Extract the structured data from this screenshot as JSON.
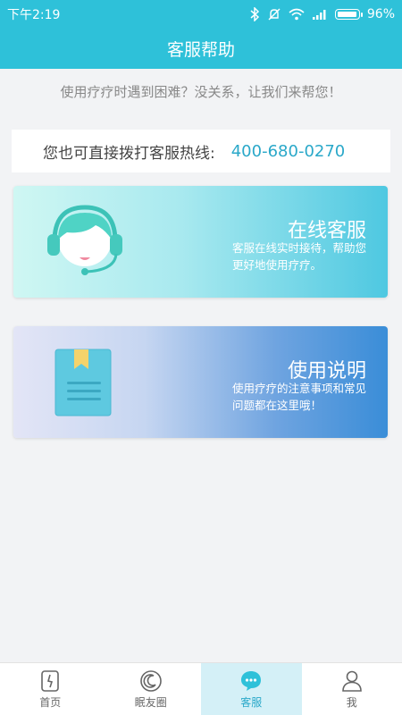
{
  "status_bar": {
    "time": "下午2:19",
    "battery": "96%",
    "battery_level": 0.96
  },
  "header": {
    "title": "客服帮助"
  },
  "tip": "使用疗疗时遇到困难？没关系，让我们来帮您！",
  "hotline": {
    "label": "您也可直接拨打客服热线:",
    "number": "400-680-0270"
  },
  "cards": [
    {
      "title": "在线客服",
      "desc": "客服在线实时接待，帮助您更好地使用疗疗。",
      "icon": "headset-agent-icon"
    },
    {
      "title": "使用说明",
      "desc": "使用疗疗的注意事项和常见问题都在这里哦！",
      "icon": "manual-book-icon"
    }
  ],
  "tabs": [
    {
      "label": "首页",
      "icon": "home-icon"
    },
    {
      "label": "眠友圈",
      "icon": "moon-circle-icon"
    },
    {
      "label": "客服",
      "icon": "chat-bubble-icon",
      "active": true
    },
    {
      "label": "我",
      "icon": "person-icon"
    }
  ]
}
